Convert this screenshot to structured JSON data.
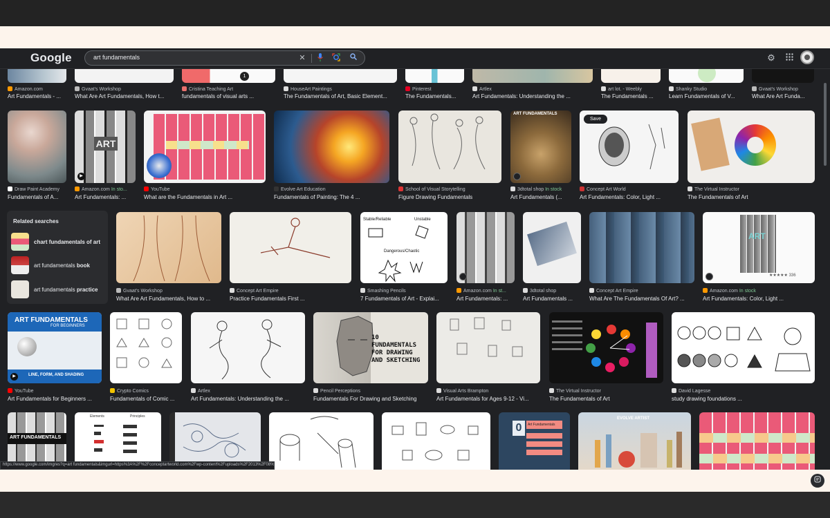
{
  "header": {
    "logo": "Google",
    "query": "art fundamentals",
    "icons": [
      "close-icon",
      "mic-icon",
      "lens-icon",
      "search-icon",
      "gear-icon",
      "apps-icon",
      "avatar"
    ]
  },
  "row0": [
    {
      "source": "Amazon.com",
      "title": "Art Fundamentals - ..."
    },
    {
      "source": "Gvaat's Workshop",
      "title": "What Are Art Fundamentals, How t..."
    },
    {
      "source": "Cristina Teaching Art",
      "title": "fundamentals of visual arts ..."
    },
    {
      "source": "HouseArt Paintings",
      "title": "The Fundamentals of Art, Basic Element..."
    },
    {
      "source": "Pinterest",
      "title": "The Fundamentals..."
    },
    {
      "source": "Artlex",
      "title": "Art Fundamentals: Understanding the ..."
    },
    {
      "source": "art lot. - Weebly",
      "title": "The Fundamentals ..."
    },
    {
      "source": "Shanky Studio",
      "title": "Learn Fundamentals of V..."
    },
    {
      "source": "Gvaat's Workshop",
      "title": "What Are Art Funda..."
    }
  ],
  "row1": [
    {
      "source": "Draw Paint Academy",
      "title": "Fundamentals of A..."
    },
    {
      "source": "Amazon.com",
      "stock": "In sto...",
      "title": "Art Fundamentals: ..."
    },
    {
      "source": "YouTube",
      "title": "What are the Fundamentals in Art ..."
    },
    {
      "source": "Evolve Art Education",
      "title": "Fundamentals of Painting: The 4 ..."
    },
    {
      "source": "School of Visual Storytelling",
      "title": "Figure Drawing Fundamentals"
    },
    {
      "source": "3dtotal shop",
      "stock": "In stock",
      "title": "Art Fundamentals (..."
    },
    {
      "source": "Concept Art World",
      "title": "Art Fundamentals: Color, Light ...",
      "save": "Save"
    },
    {
      "source": "The Virtual Instructor",
      "title": "The Fundamentals of Art"
    }
  ],
  "related": {
    "heading": "Related searches",
    "items": [
      {
        "prefix": "chart fundamentals of art",
        "bold": ""
      },
      {
        "prefix": "art fundamentals ",
        "bold": "book"
      },
      {
        "prefix": "art fundamentals ",
        "bold": "practice"
      }
    ]
  },
  "row2": [
    {
      "source": "Gvaat's Workshop",
      "title": "What Are Art Fundamentals, How to ..."
    },
    {
      "source": "Concept Art Empire",
      "title": "Practice Fundamentals First ..."
    },
    {
      "source": "Smashing Pencils",
      "title": "7 Fundamentals of Art - Explai..."
    },
    {
      "source": "Amazon.com",
      "stock": "In st...",
      "title": "Art Fundamentals: ..."
    },
    {
      "source": "3dtotal shop",
      "title": "Art Fundamentals ..."
    },
    {
      "source": "Concept Art Empire",
      "title": "What Are The Fundamentals Of Art? ..."
    },
    {
      "source": "Amazon.com",
      "stock": "In stock",
      "title": "Art Fundamentals: Color, Light ..."
    }
  ],
  "row2_text": {
    "stable": "Stable/Reliable",
    "unstable": "Unstable",
    "dangerous": "Dangerous/Chaotic",
    "book_art": "ART",
    "rating": "336"
  },
  "row1_text": {
    "book_art": "ART",
    "fund_label": "ART FUNDAMENTALS"
  },
  "row3": [
    {
      "source": "YouTube",
      "title": "Art Fundamentals for Beginners ..."
    },
    {
      "source": "Crypto Comics",
      "title": "Fundamentals of Comic ..."
    },
    {
      "source": "Artlex",
      "title": "Art Fundamentals: Understanding the ..."
    },
    {
      "source": "Pencil Perceptions",
      "title": "Fundamentals For Drawing and Sketching"
    },
    {
      "source": "Visual Arts Brampton",
      "title": "Art Fundamentals for Ages 9-12 - Vi..."
    },
    {
      "source": "The Virtual Instructor",
      "title": "The Fundamentals of Art"
    },
    {
      "source": "David Lagesse",
      "title": "study drawing foundations ..."
    }
  ],
  "row3_text": {
    "yt_title": "ART FUNDAMENTALS",
    "yt_sub": "FOR BEGINNERS",
    "yt_bottom": "LINE, FORM, AND SHADING",
    "head_text": "10 FUNDAMENTALS FOR DRAWING AND SKETCHING"
  },
  "row4_text": {
    "book": "ART FUNDAMENTALS",
    "elements": "Elements",
    "principles": "Principles",
    "evolve": "EVOLVE ARTIST",
    "zero": "0",
    "af": "Art Fundamentals"
  },
  "statusbar": "https://www.google.com/imgres?q=art fundamentals&imgurl=https%3A%2F%2Fconceptartworld.com%2Fwp-content%2Fuploads%2F2013%2F08%2F3D_Tot...",
  "colors": {
    "background": "#202124",
    "text": "#e8eaed",
    "source_text": "#bdc1c6",
    "in_stock": "#81c995"
  }
}
